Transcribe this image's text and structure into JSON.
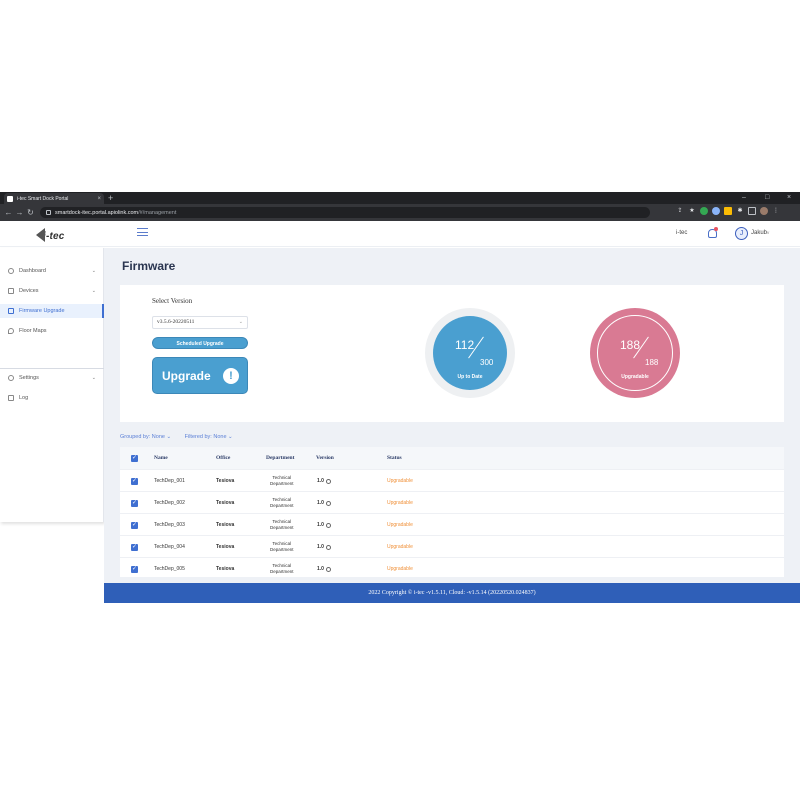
{
  "browser": {
    "tab_title": "i-tec Smart Dock Portal",
    "tab_close": "×",
    "new_tab": "+",
    "url_host": "smartdock-itec.portal.apiolink.com",
    "url_path": "/#/management",
    "window_controls": {
      "minimize": "–",
      "maximize": "□",
      "close": "×"
    }
  },
  "header": {
    "logo": "i-tec",
    "org": "i-tec",
    "user": "Jakub",
    "user_initial": "J",
    "user_chevron": "v"
  },
  "sidebar": {
    "items": [
      {
        "label": "Dashboard",
        "icon": "dashboard-icon",
        "chevron": "⌄"
      },
      {
        "label": "Devices",
        "icon": "devices-icon",
        "chevron": "⌄"
      },
      {
        "label": "Firmware Upgrade",
        "icon": "firmware-icon",
        "active": true
      },
      {
        "label": "Floor Maps",
        "icon": "floor-maps-icon"
      }
    ],
    "bottom_items": [
      {
        "label": "Settings",
        "icon": "gear-icon",
        "chevron": "⌄"
      },
      {
        "label": "Log",
        "icon": "log-icon"
      }
    ]
  },
  "main": {
    "title": "Firmware",
    "select_label": "Select Version",
    "selected_version": "v3.5.6-20220511",
    "scheduled_button": "Scheduled Upgrade",
    "upgrade_button": "Upgrade",
    "upgrade_icon": "!",
    "gauges": [
      {
        "value": "112",
        "total": "300",
        "caption": "Up to Date",
        "color": "#4a9fd0"
      },
      {
        "value": "188",
        "total": "188",
        "caption": "Upgradable",
        "color": "#d97a93"
      }
    ],
    "grouped_by": "Grouped by: None ⌄",
    "filtered_by": "Filtered by: None ⌄"
  },
  "table": {
    "columns": [
      "Name",
      "Office",
      "Department",
      "Version",
      "Status"
    ],
    "rows": [
      {
        "name": "TechDep_001",
        "office": "Tesiova",
        "dept1": "Technical",
        "dept2": "Department",
        "version": "1.0",
        "status": "Upgradable"
      },
      {
        "name": "TechDep_002",
        "office": "Tesiova",
        "dept1": "Technical",
        "dept2": "Department",
        "version": "1.0",
        "status": "Upgradable"
      },
      {
        "name": "TechDep_003",
        "office": "Tesiova",
        "dept1": "Technical",
        "dept2": "Department",
        "version": "1.0",
        "status": "Upgradable"
      },
      {
        "name": "TechDep_004",
        "office": "Tesiova",
        "dept1": "Technical",
        "dept2": "Department",
        "version": "1.0",
        "status": "Upgradable"
      },
      {
        "name": "TechDep_005",
        "office": "Tesiova",
        "dept1": "Technical",
        "dept2": "Department",
        "version": "1.0",
        "status": "Upgradable"
      }
    ]
  },
  "footer": {
    "text": "2022 Copyright © i-tec -v1.5.11, Cloud: -v1.5.14 (20220520.024837)"
  }
}
